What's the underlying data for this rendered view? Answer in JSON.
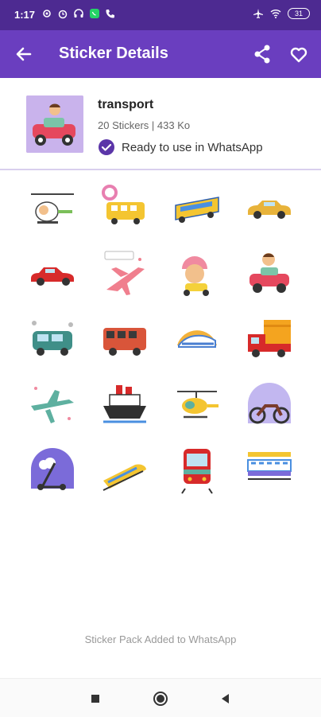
{
  "status_bar": {
    "time": "1:17",
    "battery": "31"
  },
  "app_bar": {
    "title": "Sticker Details"
  },
  "pack": {
    "name": "transport",
    "meta": "20 Stickers | 433 Ko",
    "status": "Ready to use in WhatsApp"
  },
  "stickers": [
    {
      "icon": "helicopter-sticker"
    },
    {
      "icon": "school-bus-sticker"
    },
    {
      "icon": "yellow-bus-sticker"
    },
    {
      "icon": "classic-car-sticker"
    },
    {
      "icon": "red-car-sticker"
    },
    {
      "icon": "pink-airplane-sticker"
    },
    {
      "icon": "kid-scooter-sticker"
    },
    {
      "icon": "kid-car-sticker"
    },
    {
      "icon": "van-sticker"
    },
    {
      "icon": "red-bus-sticker"
    },
    {
      "icon": "bullet-train-sticker"
    },
    {
      "icon": "truck-sticker"
    },
    {
      "icon": "green-airplane-sticker"
    },
    {
      "icon": "ship-sticker"
    },
    {
      "icon": "yellow-helicopter-sticker"
    },
    {
      "icon": "motorcycle-sticker"
    },
    {
      "icon": "kick-scooter-sticker"
    },
    {
      "icon": "high-speed-train-sticker"
    },
    {
      "icon": "metro-train-sticker"
    },
    {
      "icon": "passenger-train-sticker"
    }
  ],
  "footer_text": "Sticker Pack Added to WhatsApp",
  "colors": {
    "status_bar": "#4d2a91",
    "app_bar": "#6a3ebf",
    "accent": "#5b35a8"
  }
}
